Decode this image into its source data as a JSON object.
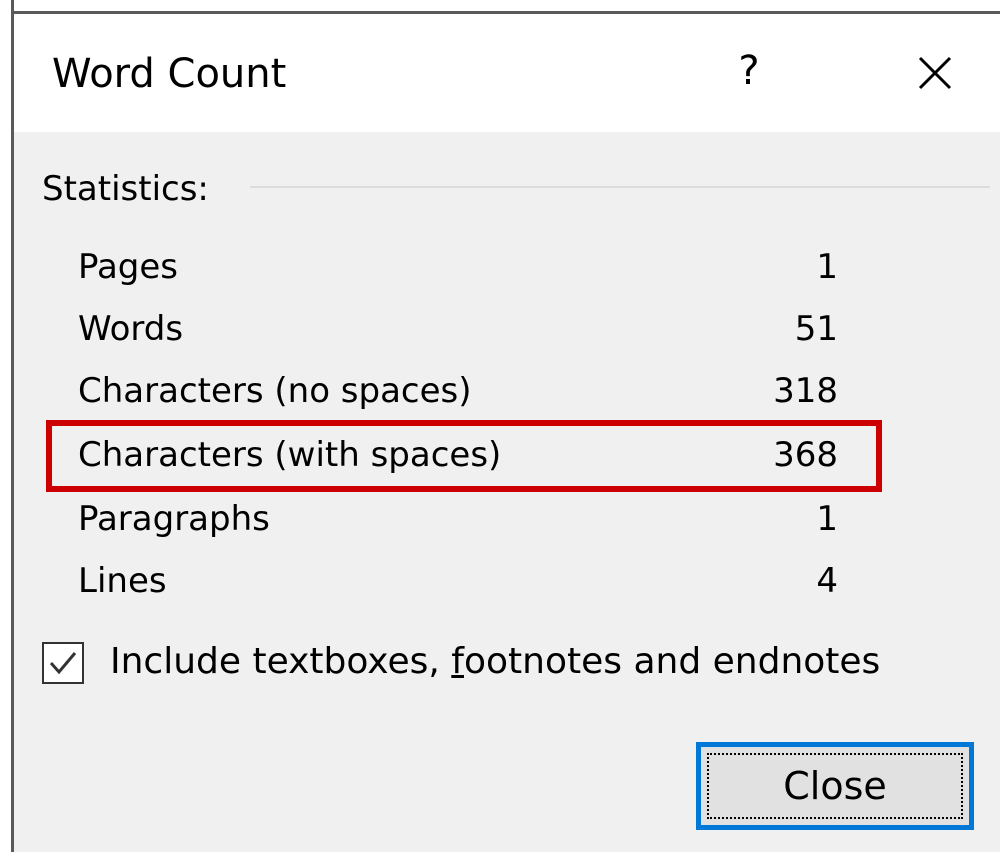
{
  "window": {
    "title": "Word Count",
    "help_label": "?"
  },
  "statistics": {
    "group_label": "Statistics:",
    "rows": [
      {
        "label": "Pages",
        "value": "1"
      },
      {
        "label": "Words",
        "value": "51"
      },
      {
        "label": "Characters (no spaces)",
        "value": "318"
      },
      {
        "label": "Characters (with spaces)",
        "value": "368"
      },
      {
        "label": "Paragraphs",
        "value": "1"
      },
      {
        "label": "Lines",
        "value": "4"
      }
    ],
    "highlighted_row": "Characters (with spaces)"
  },
  "options": {
    "include_checkbox": {
      "label_before": "Include textboxes, ",
      "label_underlined": "f",
      "label_after": "ootnotes and endnotes",
      "checked": true
    }
  },
  "buttons": {
    "close_label": "Close"
  },
  "colors": {
    "highlight": "#cc0000",
    "focus_border": "#0078d7",
    "dialog_bg": "#f0f0f0",
    "titlebar_bg": "#ffffff"
  },
  "icons": {
    "close": "close-icon",
    "checkmark": "checkmark-icon"
  }
}
